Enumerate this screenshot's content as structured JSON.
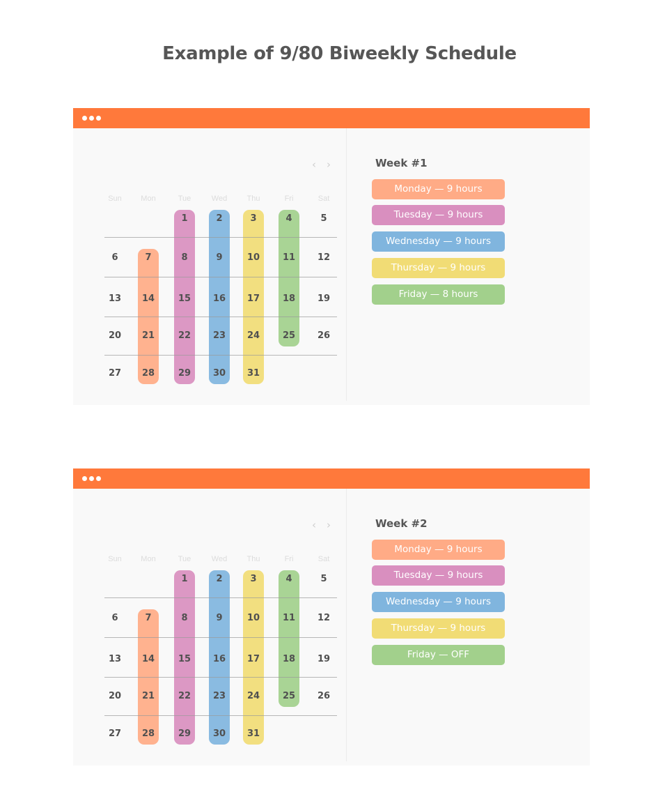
{
  "page": {
    "title": "Example of 9/80 Biweekly Schedule"
  },
  "colors": {
    "titlebar": "#ff793b",
    "monday": "#ffab86",
    "tuesday": "#d98fbf",
    "wednesday": "#80b5de",
    "thursday": "#f1dc75",
    "friday": "#a2d08c"
  },
  "calendar": {
    "weekdays": [
      "Sun",
      "Mon",
      "Tue",
      "Wed",
      "Thu",
      "Fri",
      "Sat"
    ],
    "weeks": [
      [
        "",
        "",
        "1",
        "2",
        "3",
        "4",
        "5"
      ],
      [
        "6",
        "7",
        "8",
        "9",
        "10",
        "11",
        "12"
      ],
      [
        "13",
        "14",
        "15",
        "16",
        "17",
        "18",
        "19"
      ],
      [
        "20",
        "21",
        "22",
        "23",
        "24",
        "25",
        "26"
      ],
      [
        "27",
        "28",
        "29",
        "30",
        "31",
        "",
        ""
      ]
    ],
    "prev_icon": "chevron-left-icon",
    "next_icon": "chevron-right-icon"
  },
  "panels": [
    {
      "week_title": "Week #1",
      "schedule": [
        {
          "label": "Monday — 9 hours",
          "color_key": "monday"
        },
        {
          "label": "Tuesday — 9 hours",
          "color_key": "tuesday"
        },
        {
          "label": "Wednesday — 9 hours",
          "color_key": "wednesday"
        },
        {
          "label": "Thursday — 9 hours",
          "color_key": "thursday"
        },
        {
          "label": "Friday — 8 hours",
          "color_key": "friday"
        }
      ]
    },
    {
      "week_title": "Week #2",
      "schedule": [
        {
          "label": "Monday — 9 hours",
          "color_key": "monday"
        },
        {
          "label": "Tuesday — 9 hours",
          "color_key": "tuesday"
        },
        {
          "label": "Wednesday — 9 hours",
          "color_key": "wednesday"
        },
        {
          "label": "Thursday — 9 hours",
          "color_key": "thursday"
        },
        {
          "label": "Friday — OFF",
          "color_key": "friday"
        }
      ]
    }
  ]
}
